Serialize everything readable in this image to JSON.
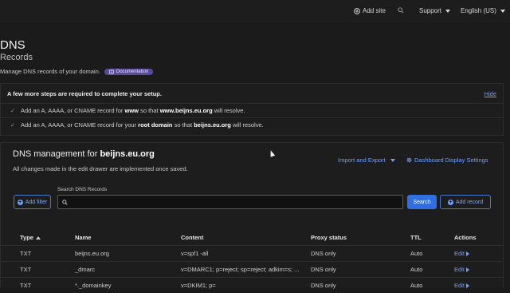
{
  "topbar": {
    "add_site": "Add site",
    "support": "Support",
    "language": "English (US)"
  },
  "page": {
    "title": "DNS",
    "subtitle": "Records",
    "description": "Manage DNS records of your domain.",
    "doc_badge": "Documentation"
  },
  "setup": {
    "heading": "A few more steps are required to complete your setup.",
    "hide": "Hide",
    "rows": [
      {
        "pre": "Add an A, AAAA, or CNAME record for ",
        "bold1": "www",
        "mid": " so that ",
        "bold2": "www.beijns.eu.org",
        "post": " will resolve."
      },
      {
        "pre": "Add an A, AAAA, or CNAME record for your ",
        "bold1": "root domain",
        "mid": " so that ",
        "bold2": "beijns.eu.org",
        "post": " will resolve."
      }
    ]
  },
  "mgmt": {
    "title_prefix": "DNS management for ",
    "domain": "beijns.eu.org",
    "subtitle": "All changes made in the edit drawer are implemented once saved.",
    "import_export": "Import and Export",
    "display_settings": "Dashboard Display Settings",
    "search_label": "Search DNS Records",
    "search_value": "",
    "add_filter": "Add filter",
    "search_button": "Search",
    "add_record": "Add record"
  },
  "table": {
    "headers": [
      "Type",
      "Name",
      "Content",
      "Proxy status",
      "TTL",
      "Actions"
    ],
    "rows": [
      {
        "type": "TXT",
        "name": "beijns.eu.org",
        "content": "v=spf1 -all",
        "proxy": "DNS only",
        "ttl": "Auto",
        "action": "Edit"
      },
      {
        "type": "TXT",
        "name": "_dmarc",
        "content": "v=DMARC1; p=reject; sp=reject; adkim=s; ...",
        "proxy": "DNS only",
        "ttl": "Auto",
        "action": "Edit"
      },
      {
        "type": "TXT",
        "name": "*._domainkey",
        "content": "v=DKIM1; p=",
        "proxy": "DNS only",
        "ttl": "Auto",
        "action": "Edit"
      }
    ]
  },
  "colors": {
    "accent": "#2f6fe0",
    "link": "#6ea0ff",
    "background": "#1b1b1b"
  }
}
